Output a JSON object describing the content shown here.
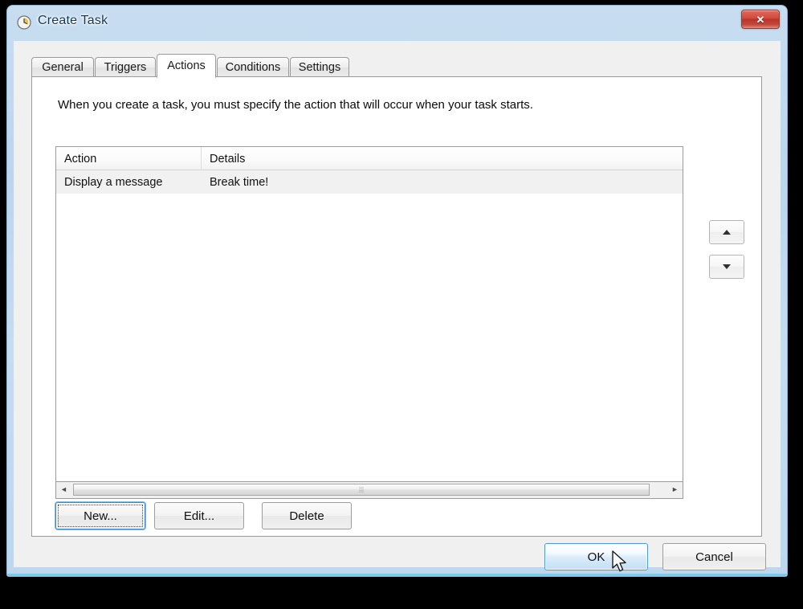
{
  "window": {
    "title": "Create Task",
    "icon": "clock-icon",
    "close_label": "✕",
    "frame_color": "#bdd7ee",
    "accent_color": "#4b9ad4"
  },
  "tabs": [
    {
      "label": "General",
      "active": false
    },
    {
      "label": "Triggers",
      "active": false
    },
    {
      "label": "Actions",
      "active": true
    },
    {
      "label": "Conditions",
      "active": false
    },
    {
      "label": "Settings",
      "active": false
    }
  ],
  "panel": {
    "instruction": "When you create a task, you must specify the action that will occur when your task starts."
  },
  "list": {
    "columns": [
      "Action",
      "Details"
    ],
    "rows": [
      {
        "action": "Display a message",
        "details": "Break time!"
      }
    ]
  },
  "scrollbar": {
    "left_arrow": "◄",
    "right_arrow": "►",
    "grip": "⦙⦙⦙"
  },
  "move_buttons": {
    "up_label": "move-up",
    "down_label": "move-down"
  },
  "action_buttons": {
    "new": "New...",
    "edit": "Edit...",
    "delete": "Delete"
  },
  "footer": {
    "ok": "OK",
    "cancel": "Cancel"
  }
}
